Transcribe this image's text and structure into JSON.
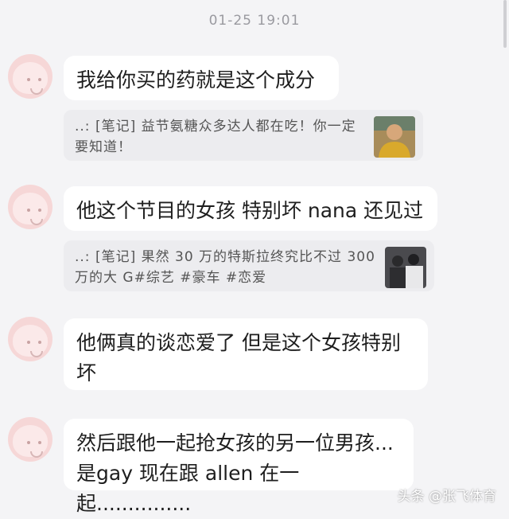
{
  "header": {
    "timestamp": "01-25 19:01"
  },
  "messages": [
    {
      "text": "我给你买的药就是这个成分"
    },
    {
      "text": "他这个节目的女孩 特别坏 nana 还见过"
    },
    {
      "text": "他俩真的谈恋爱了 但是这个女孩特别坏"
    },
    {
      "text": "然后跟他一起抢女孩的另一位男孩...是gay 现在跟 allen 在一起..............."
    }
  ],
  "notes": [
    {
      "text": "..: [笔记] 益节氨糖众多达人都在吃！你一定要知道！",
      "thumb_icon": "person-photo-icon"
    },
    {
      "text": "..: [笔记] 果然 30 万的特斯拉终究比不过 300 万的大 G#综艺 #豪车 #恋爱",
      "thumb_icon": "group-photo-icon"
    }
  ],
  "watermark": {
    "text": "头条 @张飞体育"
  },
  "colors": {
    "background": "#f4f4f6",
    "bubble": "#ffffff",
    "note": "#ececef",
    "avatar": "#f6d7d7"
  }
}
